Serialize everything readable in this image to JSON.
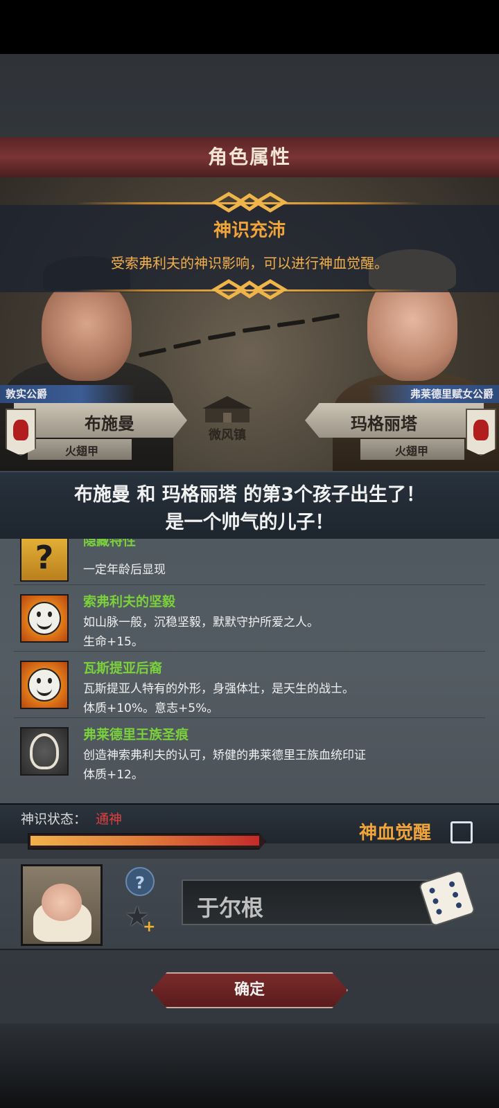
{
  "title": "角色属性",
  "banner": {
    "title": "神识充沛",
    "text": "受索弗利夫的神识影响，可以进行神血觉醒。"
  },
  "father": {
    "title": "敦实公爵",
    "name": "布施曼",
    "house": "火翅甲"
  },
  "mother": {
    "title": "弗莱德里赋女公爵",
    "name": "玛格丽塔",
    "house": "火翅甲"
  },
  "location": "微风镇",
  "announcement": {
    "line1": "布施曼 和 玛格丽塔 的第3个孩子出生了！",
    "line2": "是一个帅气的儿子！"
  },
  "traits": [
    {
      "name": "隐藏特性",
      "desc1": "",
      "desc2": "一定年龄后显现",
      "icon": "question-icon"
    },
    {
      "name": "索弗利夫的坚毅",
      "desc1": "如山脉一般，沉稳坚毅，默默守护所爱之人。",
      "desc2": "生命+15。",
      "icon": "smiley-sun-icon"
    },
    {
      "name": "瓦斯提亚后裔",
      "desc1": "瓦斯提亚人特有的外形，身强体壮，是天生的战士。",
      "desc2": "体质+10%。意志+5%。",
      "icon": "smiley-sun-icon"
    },
    {
      "name": "弗莱德里王族圣痕",
      "desc1": "创造神索弗利夫的认可，矫健的弗莱德里王族血统印证",
      "desc2": "体质+12。",
      "icon": "royal-crest-icon"
    }
  ],
  "status": {
    "label": "神识状态：",
    "value": "通神",
    "progress": 1.0,
    "awaken_label": "神血觉醒",
    "awaken_checked": false
  },
  "child": {
    "name": "于尔根"
  },
  "confirm_label": "确定",
  "colors": {
    "accent_gold": "#f0a43a",
    "trait_green": "#7bd13c",
    "status_red": "#e04040"
  }
}
